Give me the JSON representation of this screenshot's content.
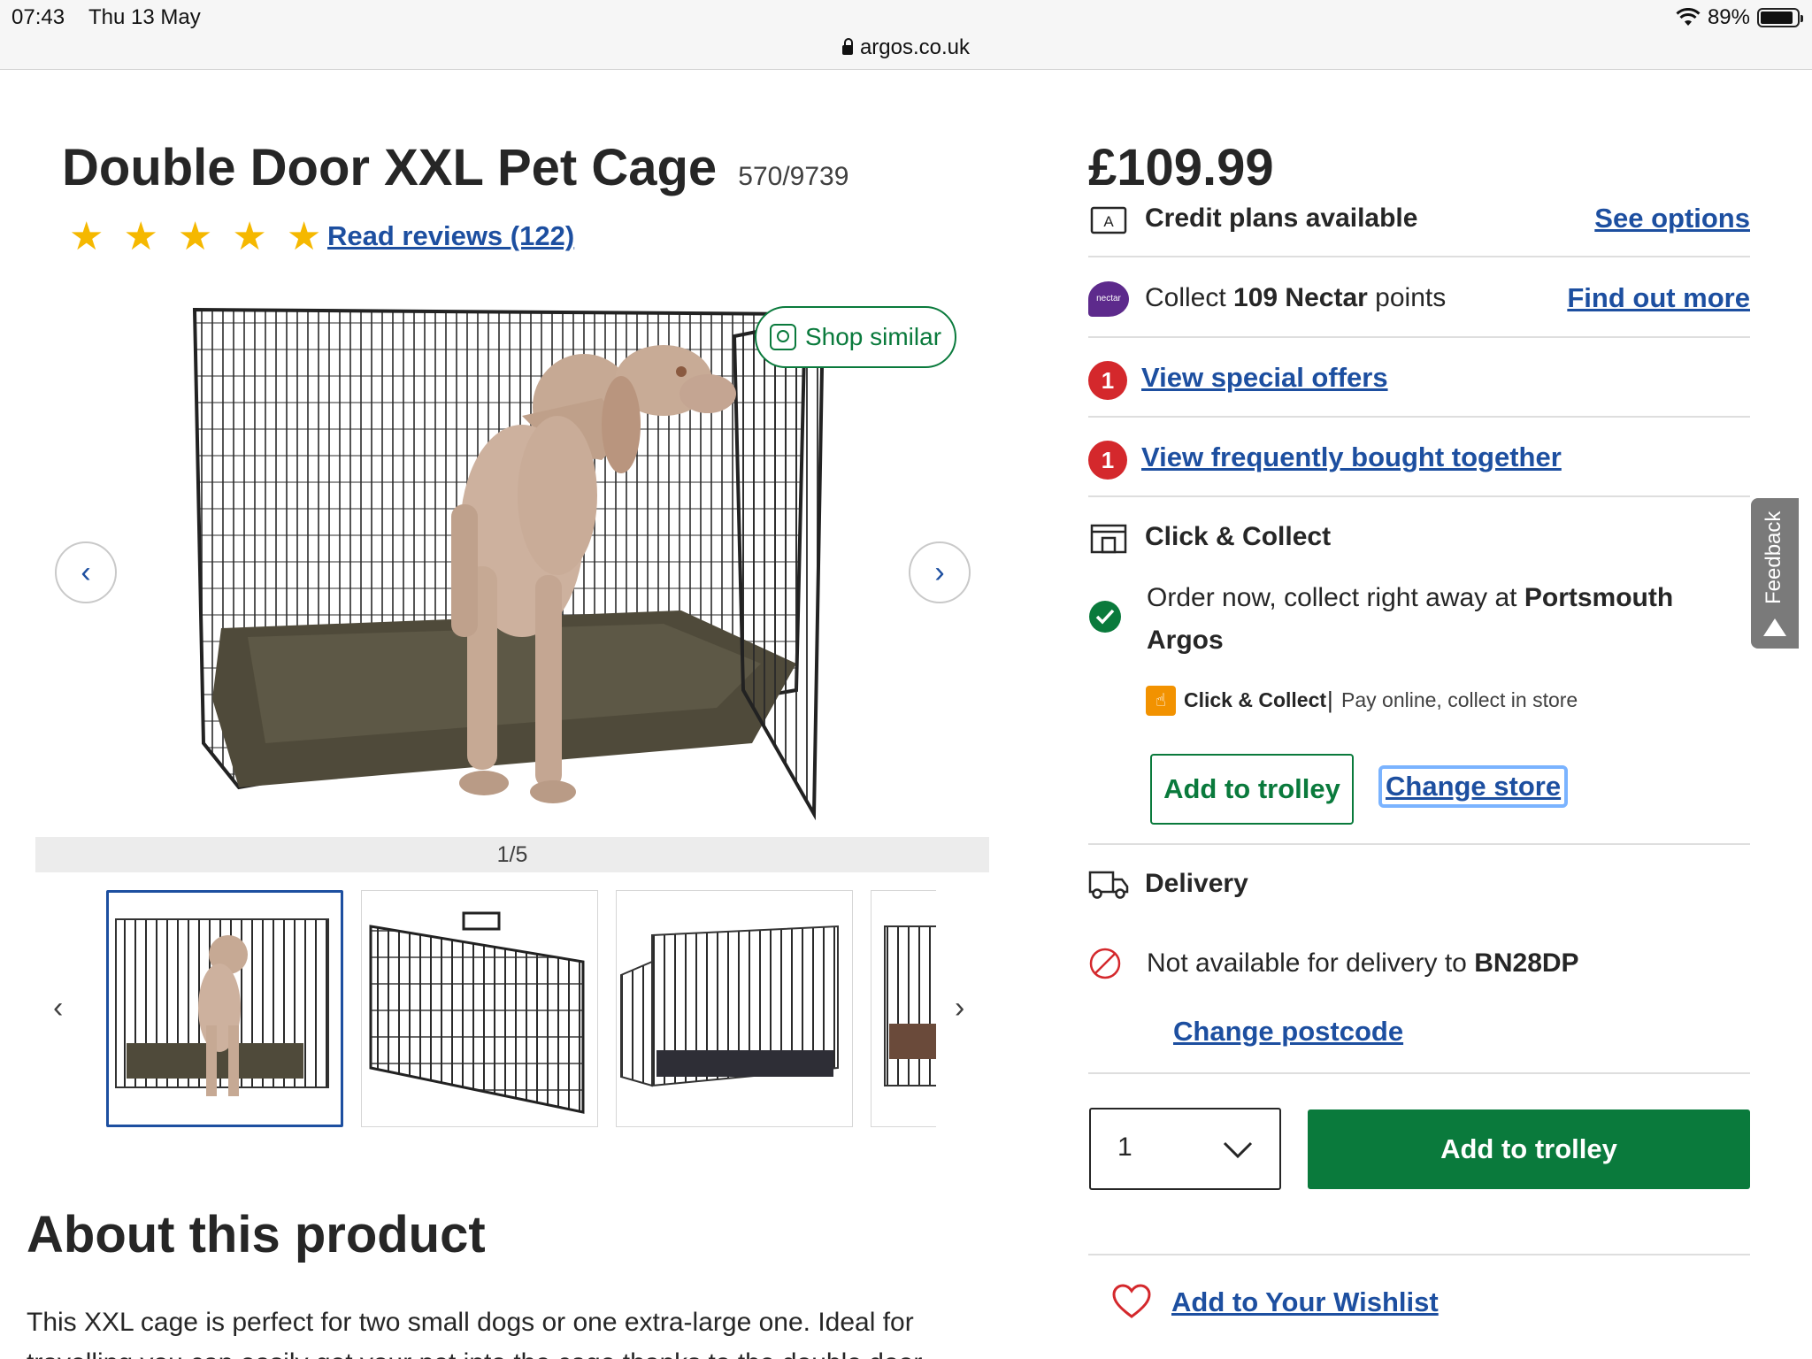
{
  "status_bar": {
    "time": "07:43",
    "date": "Thu 13 May",
    "battery": "89%",
    "battery_level": 0.89,
    "url": "argos.co.uk"
  },
  "product": {
    "title": "Double Door XXL Pet Cage",
    "sku": "570/9739",
    "rating_stars": 5,
    "reviews_link": "Read reviews (122)",
    "shop_similar": "Shop similar",
    "image_counter": "1/5"
  },
  "about": {
    "heading": "About this product",
    "description": "This XXL cage is perfect for two small dogs or one extra-large one. Ideal for travelling you can easily get your pet into the cage thanks to the double door"
  },
  "purchase": {
    "price": "£109.99",
    "credit_text": "Credit plans available",
    "credit_link": "See options",
    "nectar_prefix": "Collect ",
    "nectar_bold": "109 Nectar",
    "nectar_suffix": " points",
    "nectar_logo": "nectar",
    "nectar_link": "Find out more",
    "offers_badge": "1",
    "offers_link": "View special offers",
    "fbt_badge": "1",
    "fbt_link": "View frequently bought together",
    "collect_heading": "Click & Collect",
    "collect_text": "Order now, collect right away at ",
    "collect_store": "Portsmouth Argos",
    "cc_label": "Click & Collect",
    "cc_sep": "|",
    "cc_text": "Pay online, collect in store",
    "collect_add_button": "Add to trolley",
    "change_store": "Change store",
    "delivery_heading": "Delivery",
    "delivery_text": "Not available for delivery to ",
    "postcode": "BN28DP",
    "change_postcode": "Change postcode",
    "quantity": "1",
    "add_button": "Add to trolley",
    "wishlist_link": "Add to Your Wishlist"
  },
  "feedback_tab": "Feedback",
  "colors": {
    "brand_green": "#0a7a3c",
    "link_blue": "#1d4fa0",
    "badge_red": "#d4282c",
    "star": "#f5b800"
  }
}
